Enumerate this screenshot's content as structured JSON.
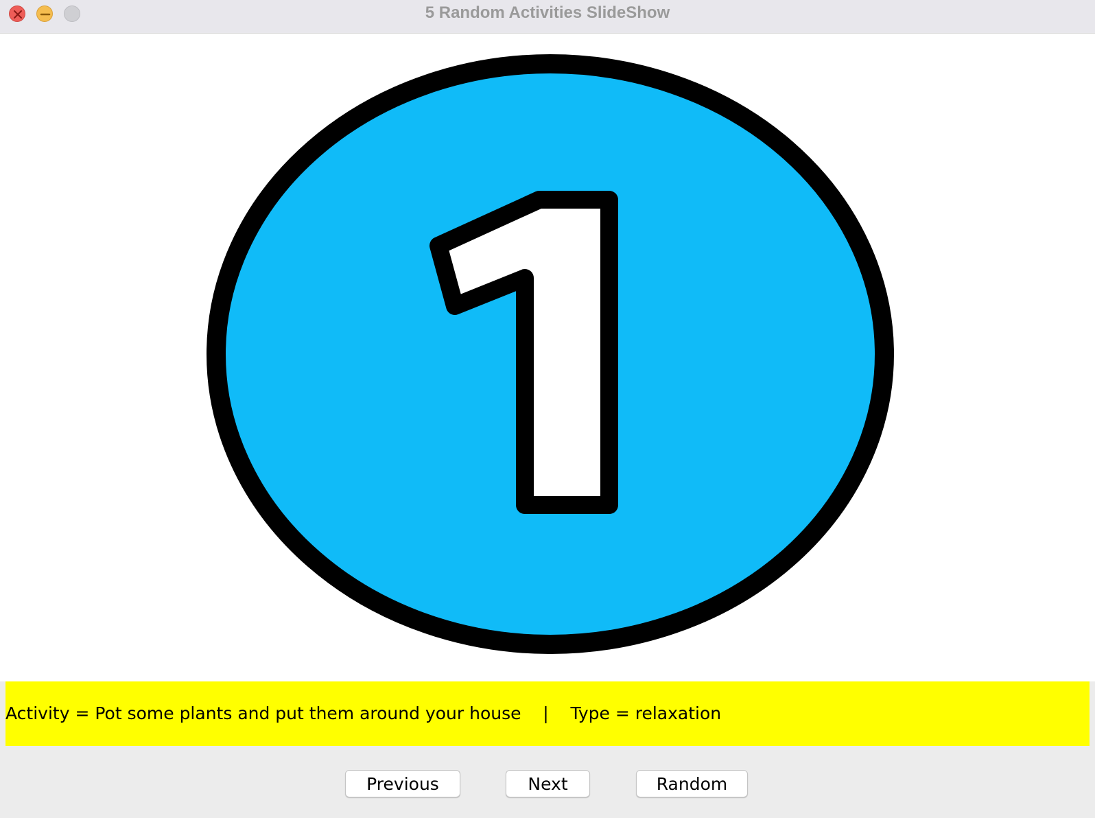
{
  "window": {
    "title": "5 Random Activities SlideShow"
  },
  "controls": {
    "close_icon": "close-icon",
    "minimize_icon": "minimize-icon",
    "zoom_icon": "zoom-icon"
  },
  "slide": {
    "number": "1",
    "circle_color": "#10bbf8",
    "outline_color": "#000000",
    "background": "#ffffff"
  },
  "info": {
    "text": "Activity = Pot some plants and put them around your house    |    Type = relaxation",
    "background": "#ffff00"
  },
  "buttons": {
    "previous": "Previous",
    "next": "Next",
    "random": "Random"
  }
}
